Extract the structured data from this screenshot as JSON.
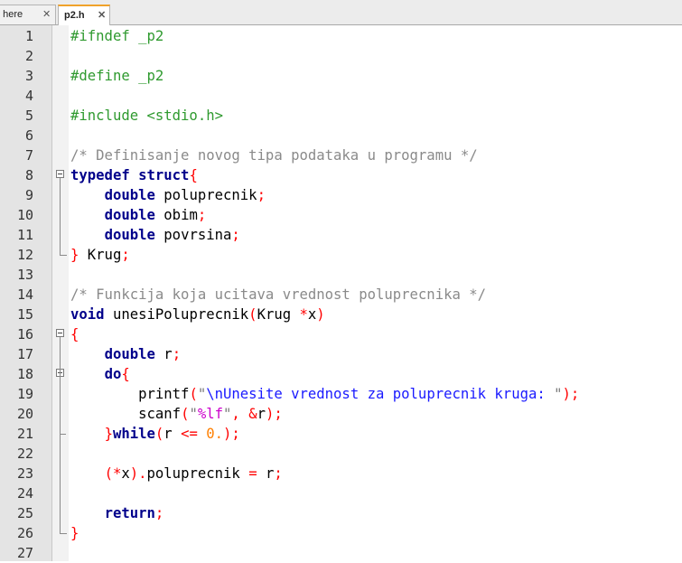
{
  "tabs": [
    {
      "label": "t here",
      "close": "✕"
    },
    {
      "label": "p2.h",
      "close": "✕",
      "active": true
    }
  ],
  "colors": {
    "preprocessor": "#2f9a2f",
    "comment": "#8a8a8a",
    "keyword": "#00008b",
    "operator": "#ff0000",
    "string": "#7a7a7a",
    "escape": "#1a1aff",
    "format": "#cc00cc",
    "number": "#ff7f00"
  },
  "lines": [
    {
      "n": "1",
      "tokens": [
        [
          "pre",
          "#ifndef _p2"
        ]
      ]
    },
    {
      "n": "2",
      "tokens": []
    },
    {
      "n": "3",
      "tokens": [
        [
          "pre",
          "#define _p2"
        ]
      ]
    },
    {
      "n": "4",
      "tokens": []
    },
    {
      "n": "5",
      "tokens": [
        [
          "pre",
          "#include <stdio.h>"
        ]
      ]
    },
    {
      "n": "6",
      "tokens": []
    },
    {
      "n": "7",
      "tokens": [
        [
          "com",
          "/* Definisanje novog tipa podataka u programu */"
        ]
      ]
    },
    {
      "n": "8",
      "fold": "open",
      "tokens": [
        [
          "kw",
          "typedef"
        ],
        [
          "id",
          " "
        ],
        [
          "kw",
          "struct"
        ],
        [
          "op",
          "{"
        ]
      ]
    },
    {
      "n": "9",
      "tokens": [
        [
          "id",
          "    "
        ],
        [
          "kw",
          "double"
        ],
        [
          "id",
          " poluprecnik"
        ],
        [
          "op",
          ";"
        ]
      ]
    },
    {
      "n": "10",
      "tokens": [
        [
          "id",
          "    "
        ],
        [
          "kw",
          "double"
        ],
        [
          "id",
          " obim"
        ],
        [
          "op",
          ";"
        ]
      ]
    },
    {
      "n": "11",
      "tokens": [
        [
          "id",
          "    "
        ],
        [
          "kw",
          "double"
        ],
        [
          "id",
          " povrsina"
        ],
        [
          "op",
          ";"
        ]
      ]
    },
    {
      "n": "12",
      "fold": "end",
      "tokens": [
        [
          "op",
          "}"
        ],
        [
          "id",
          " Krug"
        ],
        [
          "op",
          ";"
        ]
      ]
    },
    {
      "n": "13",
      "tokens": []
    },
    {
      "n": "14",
      "tokens": [
        [
          "com",
          "/* Funkcija koja ucitava vrednost poluprecnika */"
        ]
      ]
    },
    {
      "n": "15",
      "tokens": [
        [
          "kw",
          "void"
        ],
        [
          "id",
          " unesiPoluprecnik"
        ],
        [
          "op",
          "("
        ],
        [
          "id",
          "Krug "
        ],
        [
          "op",
          "*"
        ],
        [
          "id",
          "x"
        ],
        [
          "op",
          ")"
        ]
      ]
    },
    {
      "n": "16",
      "fold": "open",
      "tokens": [
        [
          "op",
          "{"
        ]
      ]
    },
    {
      "n": "17",
      "tokens": [
        [
          "id",
          "    "
        ],
        [
          "kw",
          "double"
        ],
        [
          "id",
          " r"
        ],
        [
          "op",
          ";"
        ]
      ]
    },
    {
      "n": "18",
      "fold": "open",
      "tokens": [
        [
          "id",
          "    "
        ],
        [
          "kw",
          "do"
        ],
        [
          "op",
          "{"
        ]
      ]
    },
    {
      "n": "19",
      "tokens": [
        [
          "id",
          "        printf"
        ],
        [
          "op",
          "("
        ],
        [
          "str",
          "\""
        ],
        [
          "esc",
          "\\n"
        ],
        [
          "esc",
          "Unesite vrednost za poluprecnik kruga: "
        ],
        [
          "str",
          "\""
        ],
        [
          "op",
          ");"
        ]
      ]
    },
    {
      "n": "20",
      "tokens": [
        [
          "id",
          "        scanf"
        ],
        [
          "op",
          "("
        ],
        [
          "str",
          "\""
        ],
        [
          "fmt",
          "%lf"
        ],
        [
          "str",
          "\""
        ],
        [
          "op",
          ","
        ],
        [
          "id",
          " "
        ],
        [
          "op",
          "&"
        ],
        [
          "id",
          "r"
        ],
        [
          "op",
          ");"
        ]
      ]
    },
    {
      "n": "21",
      "fold": "tick",
      "tokens": [
        [
          "id",
          "    "
        ],
        [
          "op",
          "}"
        ],
        [
          "kw",
          "while"
        ],
        [
          "op",
          "("
        ],
        [
          "id",
          "r "
        ],
        [
          "op",
          "<="
        ],
        [
          "id",
          " "
        ],
        [
          "num",
          "0."
        ],
        [
          "op",
          ");"
        ]
      ]
    },
    {
      "n": "22",
      "tokens": []
    },
    {
      "n": "23",
      "tokens": [
        [
          "id",
          "    "
        ],
        [
          "op",
          "(*"
        ],
        [
          "id",
          "x"
        ],
        [
          "op",
          ")."
        ],
        [
          "id",
          "poluprecnik "
        ],
        [
          "op",
          "="
        ],
        [
          "id",
          " r"
        ],
        [
          "op",
          ";"
        ]
      ]
    },
    {
      "n": "24",
      "tokens": []
    },
    {
      "n": "25",
      "tokens": [
        [
          "id",
          "    "
        ],
        [
          "kw",
          "return"
        ],
        [
          "op",
          ";"
        ]
      ]
    },
    {
      "n": "26",
      "fold": "end",
      "tokens": [
        [
          "op",
          "}"
        ]
      ]
    },
    {
      "n": "27",
      "tokens": []
    }
  ]
}
